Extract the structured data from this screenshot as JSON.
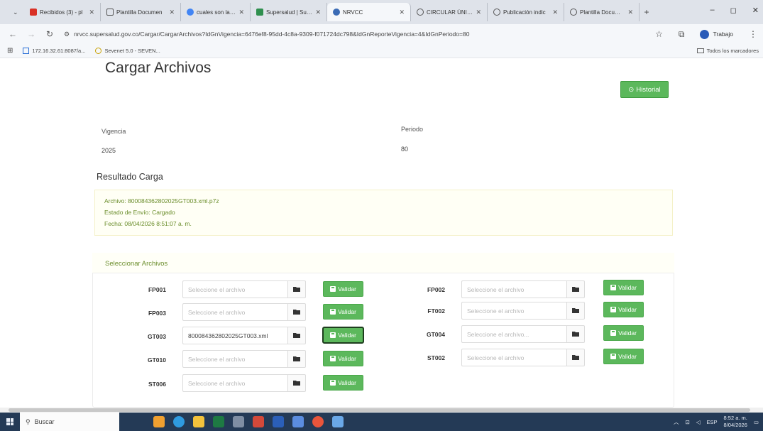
{
  "browser": {
    "tabs": [
      {
        "label": "Recibidos (3) - pl",
        "icon": "gmail-icon",
        "color": "#d93025"
      },
      {
        "label": "Plantilla Documen",
        "icon": "globe-icon",
        "color": "#555555"
      },
      {
        "label": "cuales son las tab",
        "icon": "google-icon",
        "color": "#4285f4"
      },
      {
        "label": "Supersalud | Supe",
        "icon": "supersalud-icon",
        "color": "#2f8f4e"
      },
      {
        "label": "NRVCC",
        "icon": "nrvcc-icon",
        "color": "#3b6bb5"
      },
      {
        "label": "CIRCULAR ÚNICA",
        "icon": "globe-icon",
        "color": "#555555"
      },
      {
        "label": "Publicación indic",
        "icon": "globe-icon",
        "color": "#555555"
      },
      {
        "label": "Plantilla Documen",
        "icon": "globe-icon",
        "color": "#555555"
      }
    ],
    "new_tab": "+",
    "window_controls": {
      "minimize": "–",
      "restore": "◻",
      "close": "✕"
    },
    "url": "nrvcc.supersalud.gov.co/Cargar/CargarArchivos?IdGnVigencia=6476ef8-95dd-4c8a-9309-f071724dc798&IdGnReporteVigencia=4&IdGnPeriodo=80",
    "profile_label": "Trabajo",
    "bookmarks": [
      {
        "label": "172.16.32.61:8087/a..."
      },
      {
        "label": "Sevenet 5.0 - SEVEN..."
      }
    ],
    "all_bookmarks": "Todos los marcadores"
  },
  "page": {
    "title": "Cargar Archivos",
    "historial_label": "Historial",
    "vigencia_label": "Vigencia",
    "vigencia_value": "2025",
    "periodo_label": "Periodo",
    "periodo_value": "80",
    "resultado_title": "Resultado Carga",
    "resultado": {
      "archivo": "Archivo: 800084362802025GT003.xml.p7z",
      "estado": "Estado de Envío: Cargado",
      "fecha": "Fecha: 08/04/2026 8:51:07 a. m."
    },
    "seleccionar_title": "Seleccionar Archivos",
    "validar_label": "Validar",
    "files": [
      {
        "code": "FP001",
        "value": "",
        "placeholder": "Seleccione el archivo"
      },
      {
        "code": "FP002",
        "value": "",
        "placeholder": "Seleccione el archivo"
      },
      {
        "code": "FP003",
        "value": "",
        "placeholder": "Seleccione el archivo"
      },
      {
        "code": "FT002",
        "value": "",
        "placeholder": "Seleccione el archivo"
      },
      {
        "code": "GT003",
        "value": "800084362802025GT003.xml",
        "placeholder": "Seleccione el archivo"
      },
      {
        "code": "GT004",
        "value": "",
        "placeholder": "Seleccione el archivo..."
      },
      {
        "code": "GT010",
        "value": "",
        "placeholder": "Seleccione el archivo"
      },
      {
        "code": "ST002",
        "value": "",
        "placeholder": "Seleccione el archivo"
      },
      {
        "code": "ST006",
        "value": "",
        "placeholder": "Seleccione el archivo"
      }
    ]
  },
  "taskbar": {
    "search_label": "Buscar",
    "lang": "ESP",
    "time": "8:52 a. m.",
    "date": "8/04/2026"
  },
  "colors": {
    "accent_green": "#5cb85c",
    "result_text": "#6a8d2a",
    "taskbar": "#243a56"
  }
}
